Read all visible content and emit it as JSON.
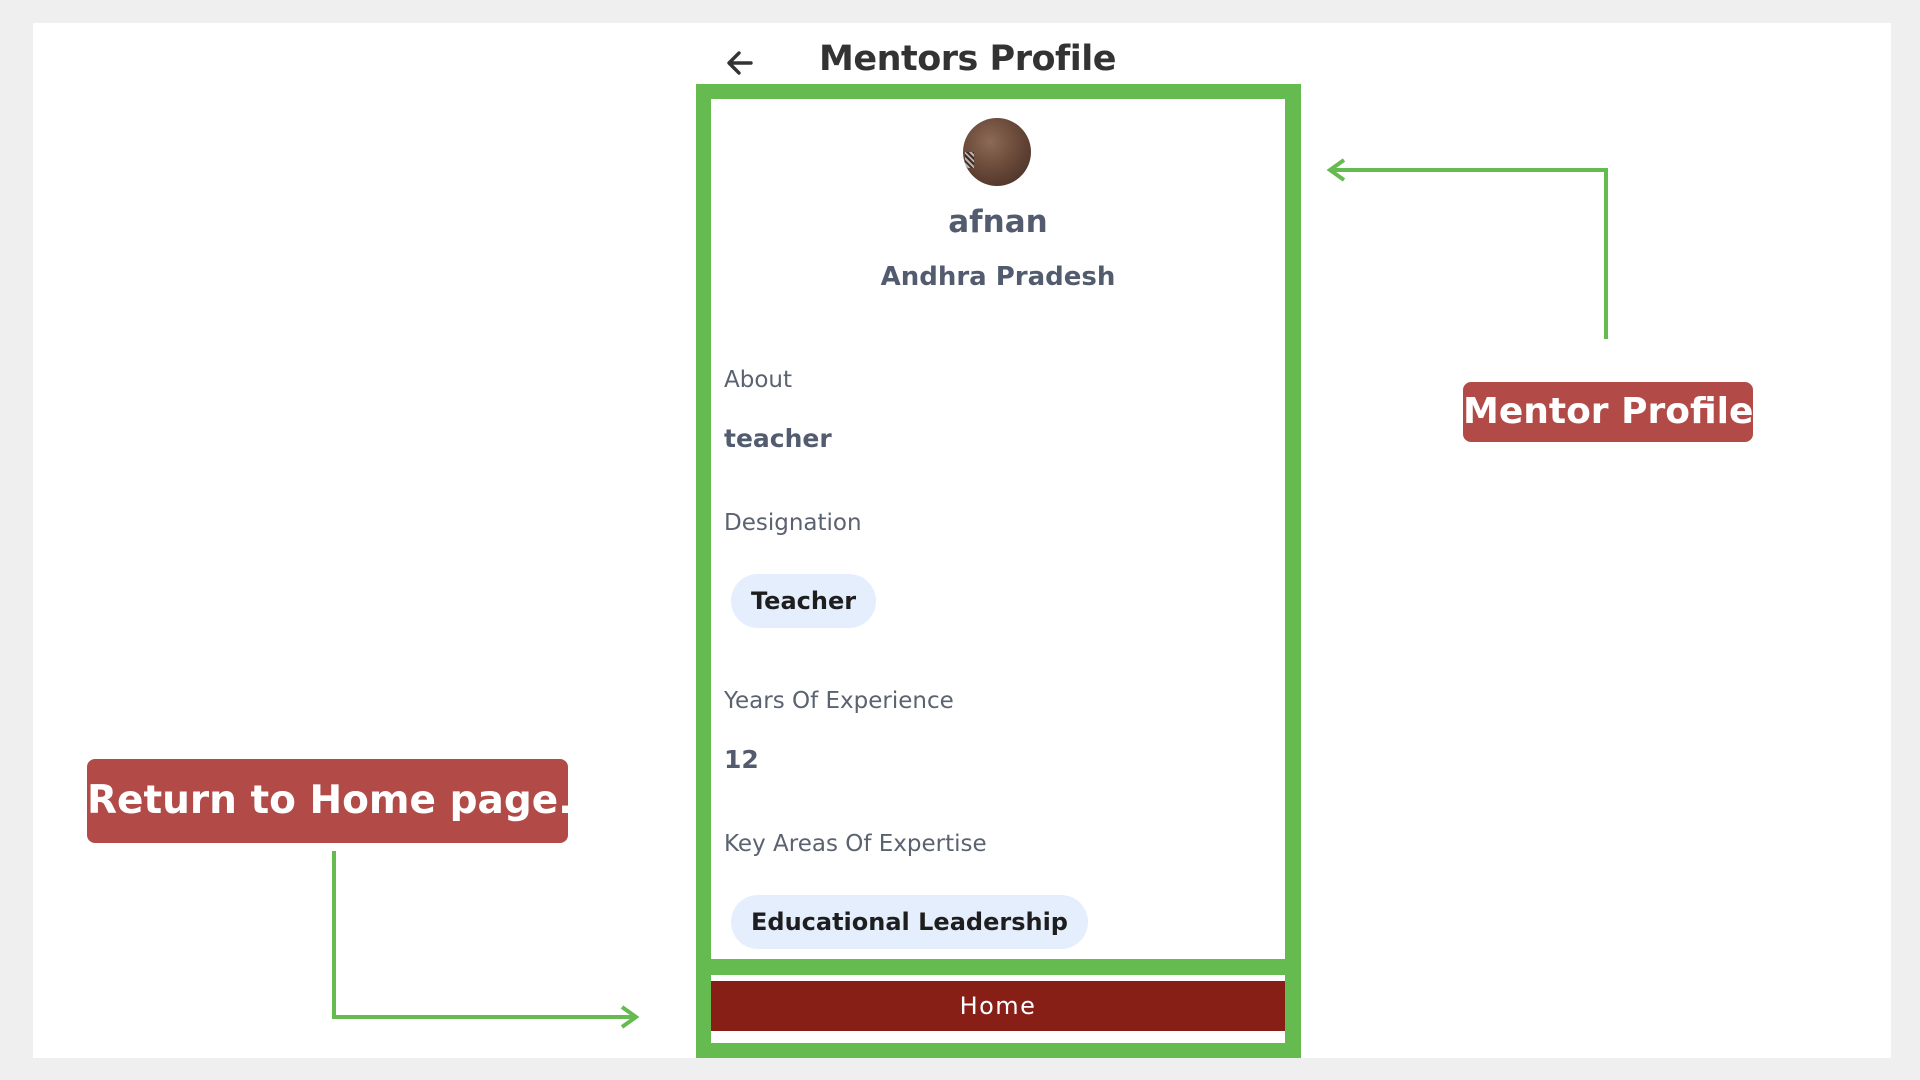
{
  "header": {
    "back_icon": "arrow-left-icon",
    "title": "Mentors Profile"
  },
  "profile": {
    "avatar": "avatar-photo",
    "name": "afnan",
    "location": "Andhra Pradesh",
    "about_label": "About",
    "about_value": "teacher",
    "designation_label": "Designation",
    "designation_chip": "Teacher",
    "experience_label": "Years Of Experience",
    "experience_value": "12",
    "expertise_label": "Key Areas Of Expertise",
    "expertise_chip": "Educational Leadership"
  },
  "footer": {
    "home_label": "Home"
  },
  "annotations": {
    "mentor_profile": "Mentor Profile",
    "return_home": "Return to Home page."
  },
  "colors": {
    "highlight_green": "#66bb50",
    "callout_red": "#b24b47",
    "home_button": "#871f17",
    "chip_bg": "#e5eefc"
  }
}
